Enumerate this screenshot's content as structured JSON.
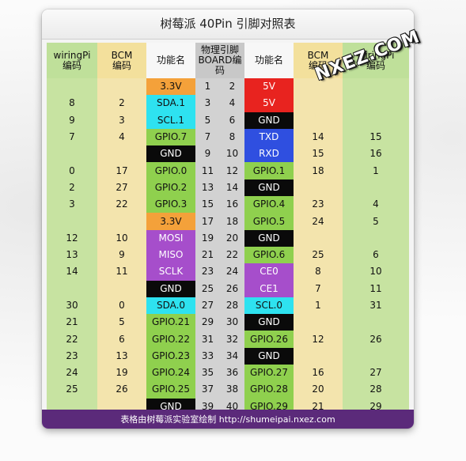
{
  "title": "树莓派 40Pin 引脚对照表",
  "headers": {
    "wiringpi_left": "wiringPi\n编码",
    "bcm_left": "BCM\n编码",
    "func_left": "功能名",
    "board": "物理引脚\nBOARD编码",
    "func_right": "功能名",
    "bcm_right": "BCM\n编码",
    "wiringpi_right": "wiringPi\n编码"
  },
  "colors": {
    "power_3v3": "#f4a13a",
    "power_5v": "#e8231f",
    "ground": "#0a0a0a",
    "i2c": "#2ee2f0",
    "uart": "#2f4fe0",
    "spi": "#a64ecb",
    "gpio": "#8fd04e",
    "wiringpi_column": "#c7e3a1",
    "bcm_column": "#f3e4ad",
    "board_column": "#d2d2d2",
    "footer": "#5b2a7a"
  },
  "rows": [
    {
      "wl": "",
      "bl": "",
      "fl": "3.3V",
      "tl": "power_3v3",
      "pl": "1",
      "pr": "2",
      "fr": "5V",
      "tr": "power_5v",
      "br": "",
      "wr": ""
    },
    {
      "wl": "8",
      "bl": "2",
      "fl": "SDA.1",
      "tl": "i2c",
      "pl": "3",
      "pr": "4",
      "fr": "5V",
      "tr": "power_5v",
      "br": "",
      "wr": ""
    },
    {
      "wl": "9",
      "bl": "3",
      "fl": "SCL.1",
      "tl": "i2c",
      "pl": "5",
      "pr": "6",
      "fr": "GND",
      "tr": "ground",
      "br": "",
      "wr": ""
    },
    {
      "wl": "7",
      "bl": "4",
      "fl": "GPIO.7",
      "tl": "gpio",
      "pl": "7",
      "pr": "8",
      "fr": "TXD",
      "tr": "uart",
      "br": "14",
      "wr": "15"
    },
    {
      "wl": "",
      "bl": "",
      "fl": "GND",
      "tl": "ground",
      "pl": "9",
      "pr": "10",
      "fr": "RXD",
      "tr": "uart",
      "br": "15",
      "wr": "16"
    },
    {
      "wl": "0",
      "bl": "17",
      "fl": "GPIO.0",
      "tl": "gpio",
      "pl": "11",
      "pr": "12",
      "fr": "GPIO.1",
      "tr": "gpio",
      "br": "18",
      "wr": "1"
    },
    {
      "wl": "2",
      "bl": "27",
      "fl": "GPIO.2",
      "tl": "gpio",
      "pl": "13",
      "pr": "14",
      "fr": "GND",
      "tr": "ground",
      "br": "",
      "wr": ""
    },
    {
      "wl": "3",
      "bl": "22",
      "fl": "GPIO.3",
      "tl": "gpio",
      "pl": "15",
      "pr": "16",
      "fr": "GPIO.4",
      "tr": "gpio",
      "br": "23",
      "wr": "4"
    },
    {
      "wl": "",
      "bl": "",
      "fl": "3.3V",
      "tl": "power_3v3",
      "pl": "17",
      "pr": "18",
      "fr": "GPIO.5",
      "tr": "gpio",
      "br": "24",
      "wr": "5"
    },
    {
      "wl": "12",
      "bl": "10",
      "fl": "MOSI",
      "tl": "spi",
      "pl": "19",
      "pr": "20",
      "fr": "GND",
      "tr": "ground",
      "br": "",
      "wr": ""
    },
    {
      "wl": "13",
      "bl": "9",
      "fl": "MISO",
      "tl": "spi",
      "pl": "21",
      "pr": "22",
      "fr": "GPIO.6",
      "tr": "gpio",
      "br": "25",
      "wr": "6"
    },
    {
      "wl": "14",
      "bl": "11",
      "fl": "SCLK",
      "tl": "spi",
      "pl": "23",
      "pr": "24",
      "fr": "CE0",
      "tr": "spi",
      "br": "8",
      "wr": "10"
    },
    {
      "wl": "",
      "bl": "",
      "fl": "GND",
      "tl": "ground",
      "pl": "25",
      "pr": "26",
      "fr": "CE1",
      "tr": "spi",
      "br": "7",
      "wr": "11"
    },
    {
      "wl": "30",
      "bl": "0",
      "fl": "SDA.0",
      "tl": "i2c",
      "pl": "27",
      "pr": "28",
      "fr": "SCL.0",
      "tr": "i2c",
      "br": "1",
      "wr": "31"
    },
    {
      "wl": "21",
      "bl": "5",
      "fl": "GPIO.21",
      "tl": "gpio",
      "pl": "29",
      "pr": "30",
      "fr": "GND",
      "tr": "ground",
      "br": "",
      "wr": ""
    },
    {
      "wl": "22",
      "bl": "6",
      "fl": "GPIO.22",
      "tl": "gpio",
      "pl": "31",
      "pr": "32",
      "fr": "GPIO.26",
      "tr": "gpio",
      "br": "12",
      "wr": "26"
    },
    {
      "wl": "23",
      "bl": "13",
      "fl": "GPIO.23",
      "tl": "gpio",
      "pl": "33",
      "pr": "34",
      "fr": "GND",
      "tr": "ground",
      "br": "",
      "wr": ""
    },
    {
      "wl": "24",
      "bl": "19",
      "fl": "GPIO.24",
      "tl": "gpio",
      "pl": "35",
      "pr": "36",
      "fr": "GPIO.27",
      "tr": "gpio",
      "br": "16",
      "wr": "27"
    },
    {
      "wl": "25",
      "bl": "26",
      "fl": "GPIO.25",
      "tl": "gpio",
      "pl": "37",
      "pr": "38",
      "fr": "GPIO.28",
      "tr": "gpio",
      "br": "20",
      "wr": "28"
    },
    {
      "wl": "",
      "bl": "",
      "fl": "GND",
      "tl": "ground",
      "pl": "39",
      "pr": "40",
      "fr": "GPIO.29",
      "tr": "gpio",
      "br": "21",
      "wr": "29"
    }
  ],
  "footer": "表格由树莓派实验室绘制 http://shumeipai.nxez.com",
  "watermark": "NXEZ.COM"
}
